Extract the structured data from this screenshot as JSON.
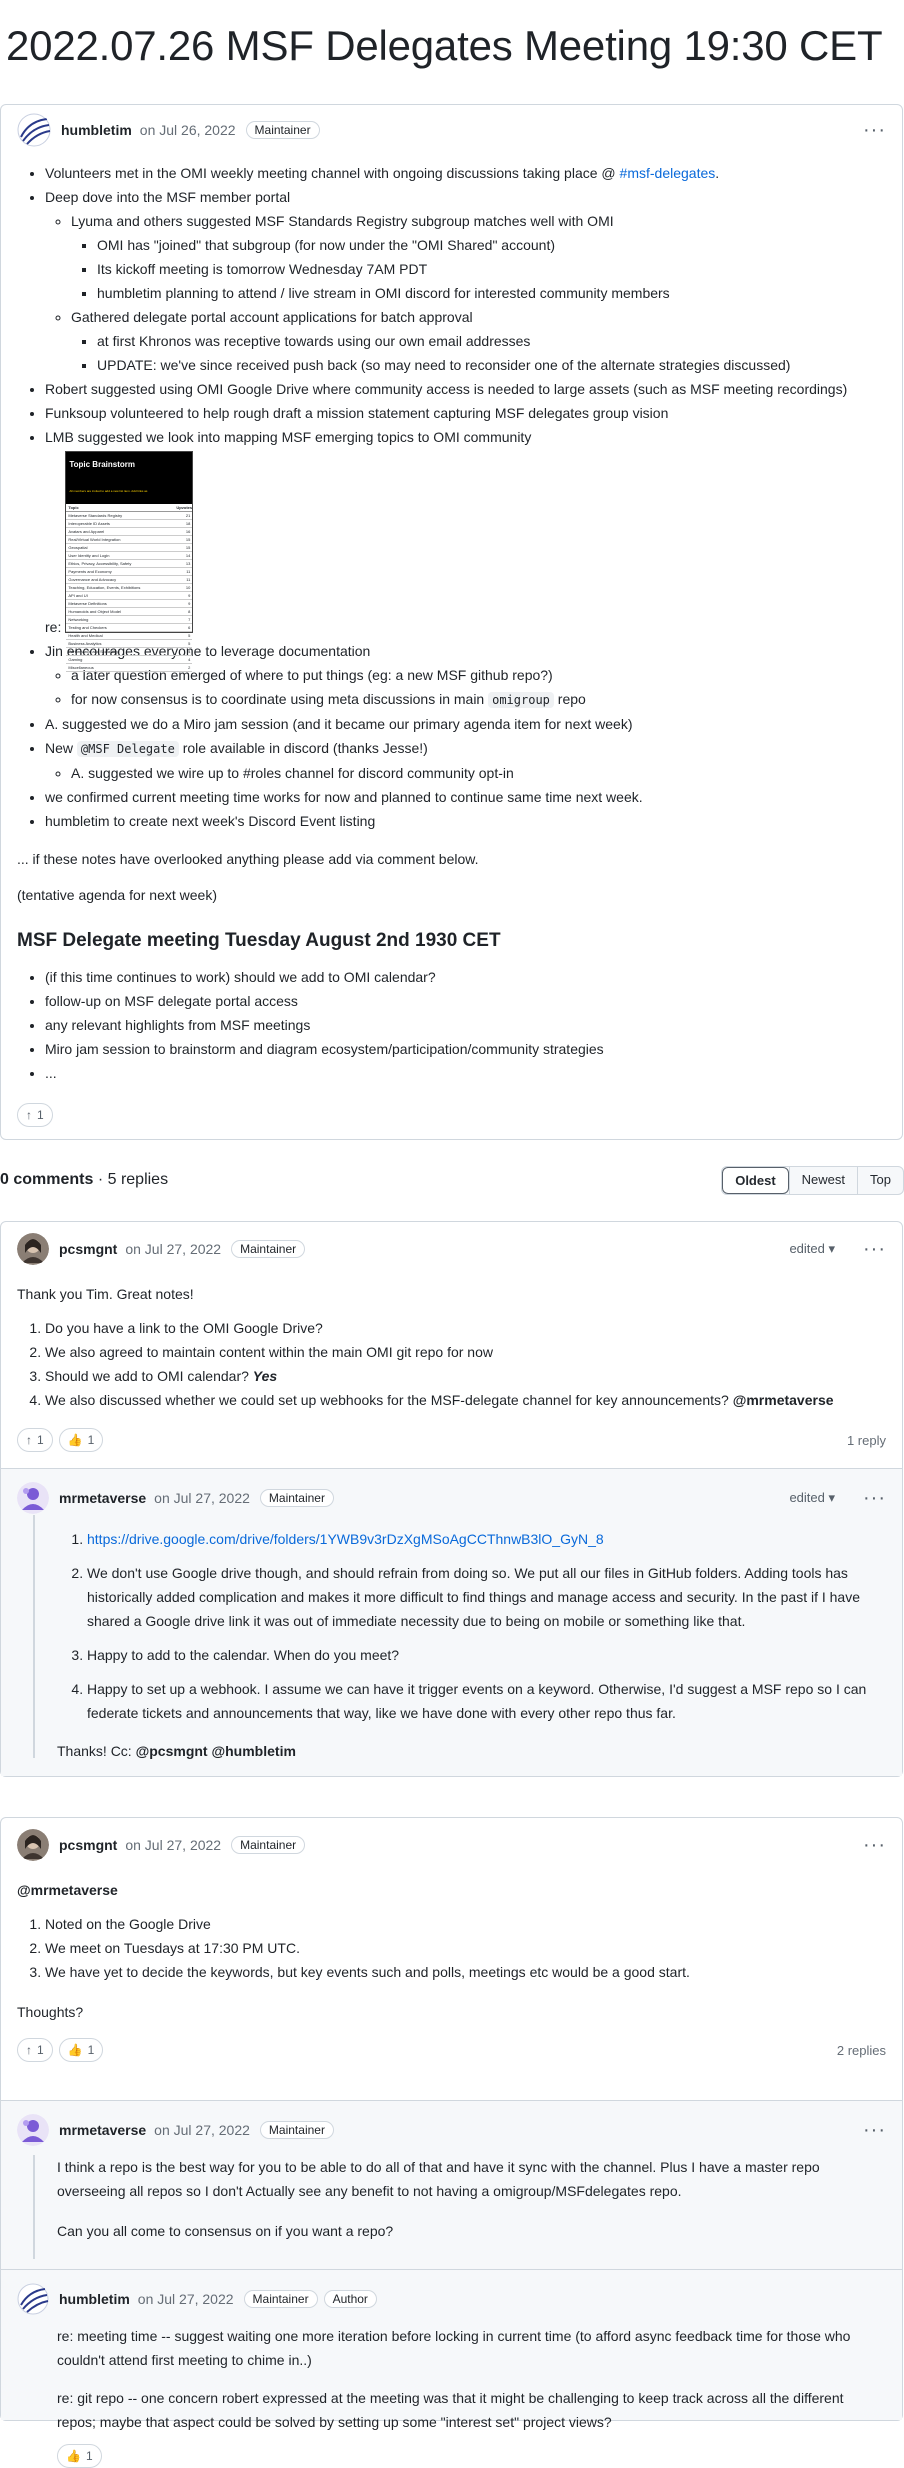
{
  "page": {
    "title": "2022.07.26 MSF Delegates Meeting 19:30 CET"
  },
  "main_post": {
    "author": "humbletim",
    "date": "on Jul 26, 2022",
    "badge": "Maintainer",
    "items": {
      "b1_pre": "Volunteers met in the OMI weekly meeting channel with ongoing discussions taking place @ ",
      "b1_link": "#msf-delegates",
      "b1_post": ".",
      "b2": "Deep dove into the MSF member portal",
      "b2_s1": "Lyuma and others suggested MSF Standards Registry subgroup matches well with OMI",
      "b2_s1_a": "OMI has \"joined\" that subgroup (for now under the \"OMI Shared\" account)",
      "b2_s1_b": "Its kickoff meeting is tomorrow Wednesday 7AM PDT",
      "b2_s1_c": "humbletim planning to attend / live stream in OMI discord for interested community members",
      "b2_s2": "Gathered delegate portal account applications for batch approval",
      "b2_s2_a": "at first Khronos was receptive towards using our own email addresses",
      "b2_s2_b": "UPDATE: we've since received push back (so may need to reconsider one of the alternate strategies discussed)",
      "b3": "Robert suggested using OMI Google Drive where community access is needed to large assets (such as MSF meeting recordings)",
      "b4": "Funksoup volunteered to help rough draft a mission statement capturing MSF delegates group vision",
      "b5": "LMB suggested we look into mapping MSF emerging topics to OMI community",
      "re_label": "re:",
      "b6": "Jin encourages everyone to leverage documentation",
      "b6_a": "a later question emerged of where to put things (eg: a new MSF github repo?)",
      "b6_b_pre": "for now consensus is to coordinate using meta discussions in main ",
      "b6_b_code": "omigroup",
      "b6_b_post": " repo",
      "b7": "A. suggested we do a Miro jam session (and it became our primary agenda item for next week)",
      "b8_pre": "New ",
      "b8_code": "@MSF Delegate",
      "b8_post": " role available in discord (thanks Jesse!)",
      "b8_a": "A. suggested we wire up to #roles channel for discord community opt-in",
      "b9": "we confirmed current meeting time works for now and planned to continue same time next week.",
      "b10": "humbletim to create next week's Discord Event listing"
    },
    "p1": "... if these notes have overlooked anything please add via comment below.",
    "p2": "(tentative agenda for next week)",
    "agenda_title": "MSF Delegate meeting Tuesday August 2nd 1930 CET",
    "agenda": [
      "(if this time continues to work) should we add to OMI calendar?",
      "follow-up on MSF delegate portal access",
      "any relevant highlights from MSF meetings",
      "Miro jam session to brainstorm and diagram ecosystem/participation/community strategies",
      "..."
    ],
    "upvotes": "1",
    "brainstorm": {
      "title": "Topic Brainstorm",
      "subtitle": "All members are invited to add a new list item. Add links as",
      "col_topic": "Topic",
      "col_votes": "Upvotes",
      "rows": [
        [
          "Metaverse Standards Registry",
          "21"
        ],
        [
          "Interoperable ID Assets",
          "18"
        ],
        [
          "Avatars and Apparel",
          "16"
        ],
        [
          "Real/Virtual World Integration",
          "15"
        ],
        [
          "Geospatial",
          "15"
        ],
        [
          "User Identity and Login",
          "14"
        ],
        [
          "Ethics, Privacy, Accessibility, Safety",
          "13"
        ],
        [
          "Payments and Economy",
          "11"
        ],
        [
          "Governance and Advocacy",
          "11"
        ],
        [
          "Teaching, Education, Events, Exhibitions",
          "10"
        ],
        [
          "API and UI",
          "9"
        ],
        [
          "Metaverse Definitions",
          "9"
        ],
        [
          "Humanoids and Object Model",
          "8"
        ],
        [
          "Networking",
          "7"
        ],
        [
          "Testing and Checkers",
          "6"
        ],
        [
          "Health and Medical",
          "5"
        ],
        [
          "Business Analytics",
          "5"
        ],
        [
          "Performance and Scalability",
          "4"
        ],
        [
          "Gaming",
          "4"
        ],
        [
          "Miscellaneous",
          "2"
        ]
      ]
    }
  },
  "comments_bar": {
    "count": "0 comments",
    "replies": " · 5 replies",
    "sort": [
      "Oldest",
      "Newest",
      "Top"
    ]
  },
  "thread1": {
    "author": "pcsmgnt",
    "date": "on Jul 27, 2022",
    "badge": "Maintainer",
    "edited": "edited",
    "intro": "Thank you Tim. Great notes!",
    "items": {
      "i1": "Do you have a link to the OMI Google Drive?",
      "i2": "We also agreed to maintain content within the main OMI git repo for now",
      "i3": "Should we add to OMI calendar? ",
      "i3_em": "Yes",
      "i4": "We also discussed whether we could set up webhooks for the MSF-delegate channel for key announcements? ",
      "i4_mention": "@mrmetaverse"
    },
    "upvotes": "1",
    "thumbs": "1",
    "reply_count": "1 reply",
    "reply": {
      "author": "mrmetaverse",
      "date": "on Jul 27, 2022",
      "badge": "Maintainer",
      "edited": "edited",
      "link": "https://drive.google.com/drive/folders/1YWB9v3rDzXgMSoAgCCThnwB3lO_GyN_8",
      "r2": "We don't use Google drive though, and should refrain from doing so. We put all our files in GitHub folders. Adding tools has historically added complication and makes it more difficult to find things and manage access and security. In the past if I have shared a Google drive link it was out of immediate necessity due to being on mobile or something like that.",
      "r3": "Happy to add to the calendar. When do you meet?",
      "r4": "Happy to set up a webhook. I assume we can have it trigger events on a keyword. Otherwise, I'd suggest a MSF repo so I can federate tickets and announcements that way, like we have done with every other repo thus far.",
      "thanks": "Thanks! Cc: ",
      "thanks_mentions": "@pcsmgnt @humbletim"
    }
  },
  "thread2": {
    "author": "pcsmgnt",
    "date": "on Jul 27, 2022",
    "badge": "Maintainer",
    "mention": "@mrmetaverse",
    "items": [
      "Noted on the Google Drive",
      "We meet on Tuesdays at 17:30 PM UTC.",
      "We have yet to decide the keywords, but key events such and polls, meetings etc would be a good start."
    ],
    "thoughts": "Thoughts?",
    "upvotes": "1",
    "thumbs": "1",
    "reply_count": "2 replies",
    "reply1": {
      "author": "mrmetaverse",
      "date": "on Jul 27, 2022",
      "badge": "Maintainer",
      "p1": "I think a repo is the best way for you to be able to do all of that and have it sync with the channel. Plus I have a master repo overseeing all repos so I don't Actually see any benefit to not having a omigroup/MSFdelegates repo.",
      "p2": "Can you all come to consensus on if you want a repo?"
    },
    "reply2": {
      "author": "humbletim",
      "date": "on Jul 27, 2022",
      "badge": "Maintainer",
      "badge2": "Author",
      "p1": "re: meeting time -- suggest waiting one more iteration before locking in current time (to afford async feedback time for those who couldn't attend first meeting to chime in..)",
      "p2": "re: git repo -- one concern robert expressed at the meeting was that it might be challenging to keep track across all the different repos; maybe that aspect could be solved by setting up some \"interest set\" project views?",
      "thumbs": "1"
    }
  }
}
